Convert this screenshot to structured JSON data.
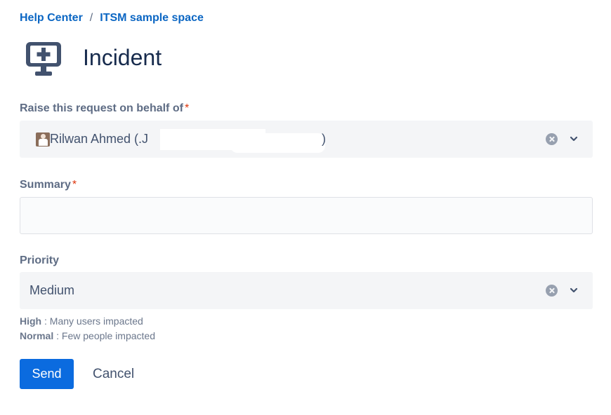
{
  "breadcrumb": {
    "home": "Help Center",
    "separator": "/",
    "space": "ITSM sample space"
  },
  "page": {
    "icon": "monitor-plus-icon",
    "title": "Incident"
  },
  "fields": {
    "on_behalf": {
      "label": "Raise this request on behalf of",
      "required_mark": "*",
      "value": "Rilwan Ahmed (.J",
      "value_end": ")"
    },
    "summary": {
      "label": "Summary",
      "required_mark": "*",
      "value": ""
    },
    "priority": {
      "label": "Priority",
      "value": "Medium"
    }
  },
  "priority_help": {
    "high_label": "High",
    "high_text": " : Many users impacted",
    "normal_label": "Normal",
    "normal_text": " : Few people impacted"
  },
  "actions": {
    "send": "Send",
    "cancel": "Cancel"
  },
  "colors": {
    "link": "#0b66c3",
    "primary_button": "#0b6bdf",
    "required": "#de350b",
    "field_bg": "#f4f5f7"
  }
}
